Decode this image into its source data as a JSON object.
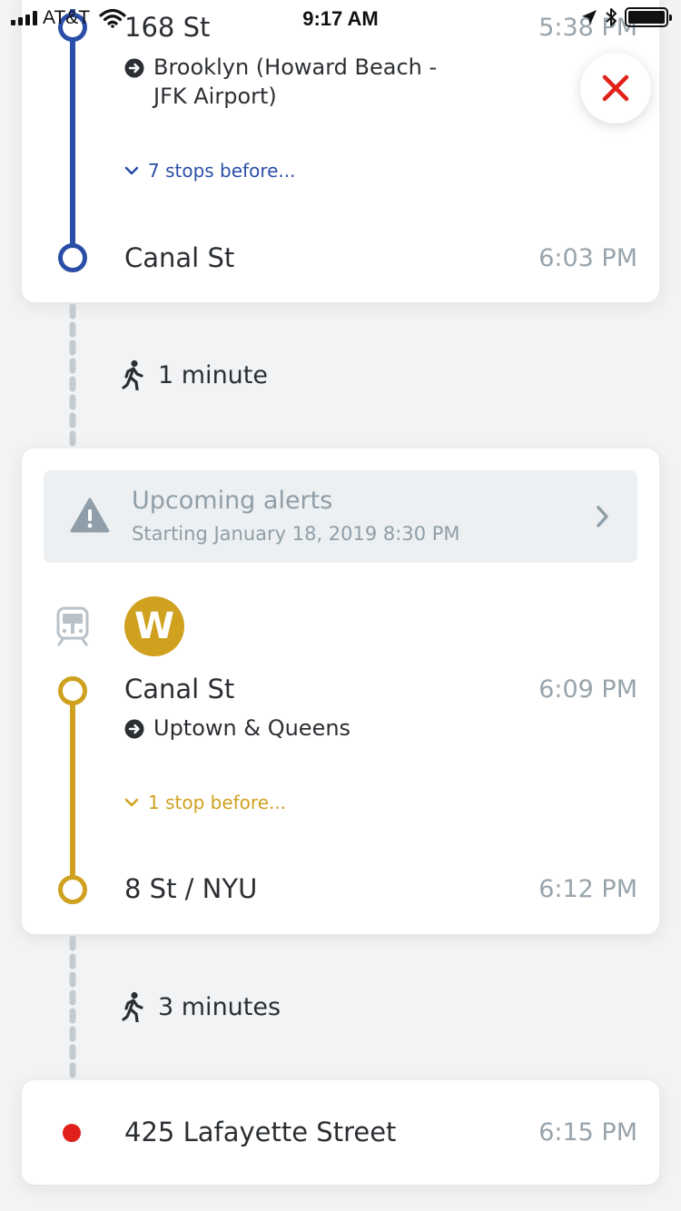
{
  "status_bar": {
    "carrier": "AT&T",
    "time": "9:17 AM"
  },
  "colors": {
    "a_line": "#2a4ea8",
    "w_line": "#cfa11f",
    "destination": "#e0211b",
    "close": "#e0211b",
    "muted": "#98a4ac"
  },
  "leg1": {
    "start_stop": "168 St",
    "start_time": "5:38 PM",
    "direction": "Brooklyn (Howard Beach - JFK Airport)",
    "stops_before": "7 stops before...",
    "end_stop": "Canal St",
    "end_time": "6:03 PM"
  },
  "walk1": {
    "label": "1 minute",
    "icon": "walking-person-icon"
  },
  "alerts": {
    "title": "Upcoming alerts",
    "subtitle": "Starting January 18, 2019 8:30 PM",
    "icon": "warning-icon"
  },
  "leg2": {
    "route_letter": "W",
    "vehicle_icon": "subway-train-icon",
    "start_stop": "Canal St",
    "start_time": "6:09 PM",
    "direction": "Uptown & Queens",
    "stops_before": "1 stop before...",
    "end_stop": "8 St / NYU",
    "end_time": "6:12 PM"
  },
  "walk2": {
    "label": "3 minutes",
    "icon": "walking-person-icon"
  },
  "destination": {
    "name": "425 Lafayette Street",
    "time": "6:15 PM"
  }
}
